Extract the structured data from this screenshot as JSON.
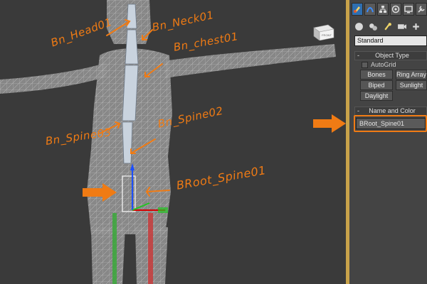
{
  "viewport": {
    "annotations": {
      "head": "Bn_Head01",
      "neck": "Bn_Neck01",
      "chest": "Bn_chest01",
      "spine03": "Bn_Spine03",
      "spine02": "Bn_Spine02",
      "root": "BRoot_Spine01"
    },
    "viewcube_label": "FRONT",
    "colors": {
      "annotation": "#f07b14",
      "mesh": "#8a8a8a",
      "background": "#3a3a3a"
    }
  },
  "command_panel": {
    "tabs": [
      "create-icon",
      "modify-icon",
      "hierarchy-icon",
      "motion-icon",
      "display-icon",
      "utilities-icon"
    ],
    "category_icons": [
      "geometry-icon",
      "shapes-icon",
      "lights-icon",
      "cameras-icon",
      "helpers-icon"
    ],
    "dropdown_value": "Standard",
    "object_type": {
      "title": "Object Type",
      "autogrid_label": "AutoGrid",
      "buttons": {
        "bones": "Bones",
        "ring_array": "Ring Array",
        "biped": "Biped",
        "sunlight": "Sunlight",
        "daylight": "Daylight"
      }
    },
    "name_and_color": {
      "title": "Name and Color",
      "name_value": "BRoot_Spine01"
    },
    "highlight_color": "#f07b14"
  }
}
